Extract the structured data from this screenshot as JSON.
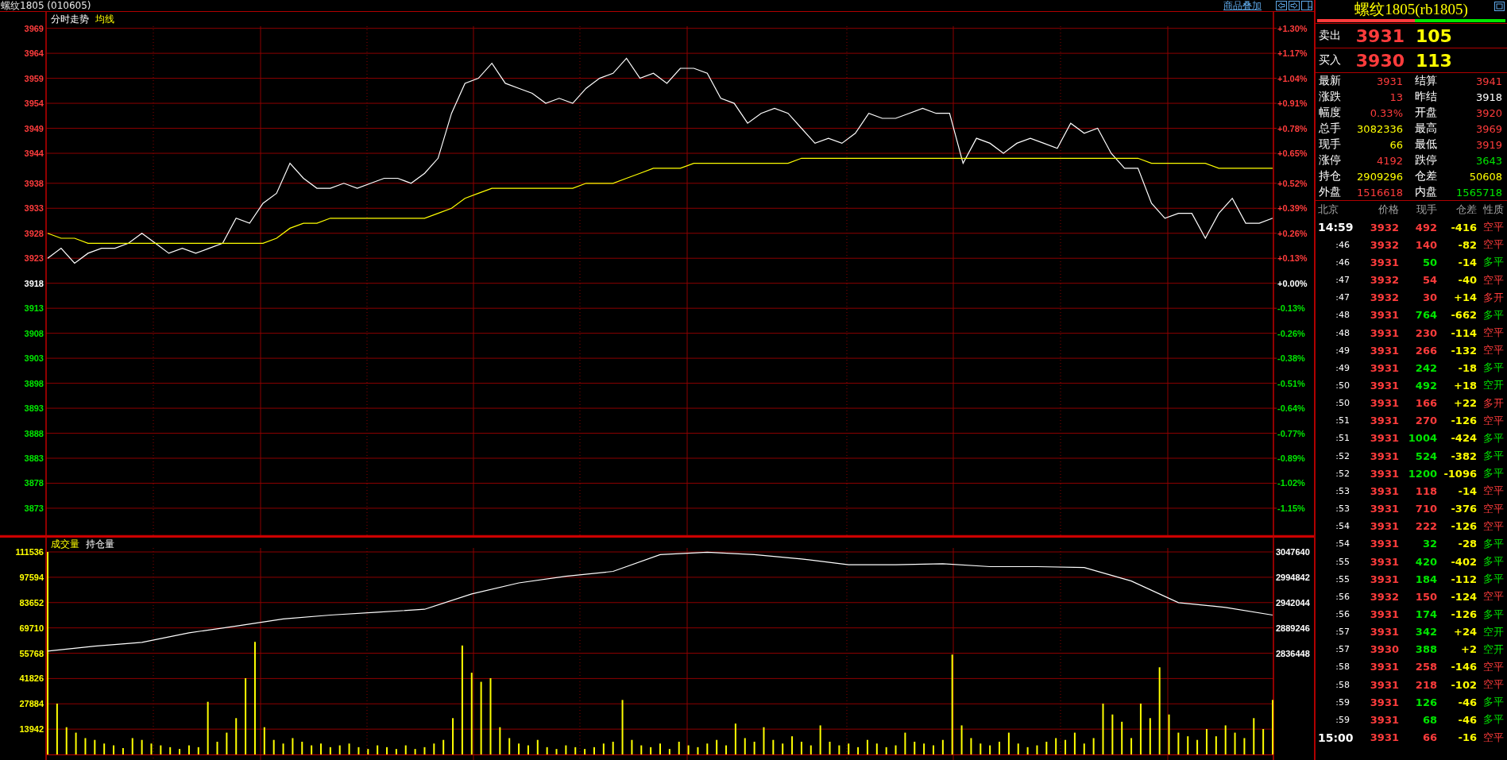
{
  "header": {
    "title": "螺纹1805 (010605)",
    "overlay_link": "商品叠加"
  },
  "price_panel": {
    "chart_data": {
      "type": "line",
      "title": "分时走势",
      "grid": true,
      "series": [
        {
          "color": "#ffffff",
          "values": [
            3923,
            3925,
            3922,
            3924,
            3925,
            3925,
            3926,
            3928,
            3926,
            3924,
            3925,
            3924,
            3925,
            3926,
            3931,
            3930,
            3934,
            3936,
            3942,
            3939,
            3937,
            3937,
            3938,
            3937,
            3938,
            3939,
            3939,
            3938,
            3940,
            3943,
            3952,
            3958,
            3959,
            3962,
            3958,
            3957,
            3956,
            3954,
            3955,
            3954,
            3957,
            3959,
            3960,
            3963,
            3959,
            3960,
            3958,
            3961,
            3961,
            3960,
            3955,
            3954,
            3950,
            3952,
            3953,
            3952,
            3949,
            3946,
            3947,
            3946,
            3948,
            3952,
            3951,
            3951,
            3952,
            3953,
            3952,
            3952,
            3942,
            3947,
            3946,
            3944,
            3946,
            3947,
            3946,
            3945,
            3950,
            3948,
            3949,
            3944,
            3941,
            3941,
            3934,
            3931,
            3932,
            3932,
            3927,
            3932,
            3935,
            3930,
            3930,
            3931
          ]
        },
        {
          "name": "均线",
          "color": "#ffff00",
          "values": [
            3928,
            3927,
            3927,
            3926,
            3926,
            3926,
            3926,
            3926,
            3926,
            3926,
            3926,
            3926,
            3926,
            3926,
            3926,
            3926,
            3926,
            3927,
            3929,
            3930,
            3930,
            3931,
            3931,
            3931,
            3931,
            3931,
            3931,
            3931,
            3931,
            3932,
            3933,
            3935,
            3936,
            3937,
            3937,
            3937,
            3937,
            3937,
            3937,
            3937,
            3938,
            3938,
            3938,
            3939,
            3940,
            3941,
            3941,
            3941,
            3942,
            3942,
            3942,
            3942,
            3942,
            3942,
            3942,
            3942,
            3943,
            3943,
            3943,
            3943,
            3943,
            3943,
            3943,
            3943,
            3943,
            3943,
            3943,
            3943,
            3943,
            3943,
            3943,
            3943,
            3943,
            3943,
            3943,
            3943,
            3943,
            3943,
            3943,
            3943,
            3943,
            3943,
            3942,
            3942,
            3942,
            3942,
            3942,
            3941,
            3941,
            3941,
            3941,
            3941
          ]
        }
      ],
      "ylim": [
        3867.75,
        3969.42
      ],
      "yticks": [
        3969,
        3964,
        3959,
        3954,
        3949,
        3944,
        3938,
        3933,
        3928,
        3923,
        3918,
        3913,
        3908,
        3903,
        3898,
        3893,
        3888,
        3883,
        3878,
        3873
      ]
    },
    "percent_axis": [
      {
        "label": "+1.30%",
        "color": "#ff3c3c"
      },
      {
        "label": "+1.17%",
        "color": "#ff3c3c"
      },
      {
        "label": "+1.04%",
        "color": "#ff3c3c"
      },
      {
        "label": "+0.91%",
        "color": "#ff3c3c"
      },
      {
        "label": "+0.78%",
        "color": "#ff3c3c"
      },
      {
        "label": "+0.65%",
        "color": "#ff3c3c"
      },
      {
        "label": "+0.52%",
        "color": "#ff3c3c"
      },
      {
        "label": "+0.39%",
        "color": "#ff3c3c"
      },
      {
        "label": "+0.26%",
        "color": "#ff3c3c"
      },
      {
        "label": "+0.13%",
        "color": "#ff3c3c"
      },
      {
        "label": "+0.00%",
        "color": "#ffffff"
      },
      {
        "label": "-0.13%",
        "color": "#00e600"
      },
      {
        "label": "-0.26%",
        "color": "#00e600"
      },
      {
        "label": "-0.38%",
        "color": "#00e600"
      },
      {
        "label": "-0.51%",
        "color": "#00e600"
      },
      {
        "label": "-0.64%",
        "color": "#00e600"
      },
      {
        "label": "-0.77%",
        "color": "#00e600"
      },
      {
        "label": "-0.89%",
        "color": "#00e600"
      },
      {
        "label": "-1.02%",
        "color": "#00e600"
      },
      {
        "label": "-1.15%",
        "color": "#00e600"
      }
    ]
  },
  "volume_panel": {
    "volume": {
      "chart_data": {
        "type": "bar",
        "grid": true,
        "series": [
          {
            "name": "成交量",
            "color": "#ffff00",
            "values": [
              111500,
              28000,
              15000,
              12000,
              9000,
              8000,
              6000,
              5000,
              3500,
              9000,
              8000,
              6000,
              5000,
              4000,
              3000,
              5000,
              4000,
              29000,
              7000,
              12000,
              20000,
              42000,
              62000,
              15000,
              8000,
              6000,
              9000,
              7000,
              5000,
              6000,
              4000,
              5000,
              6000,
              4000,
              3000,
              5000,
              4000,
              3000,
              5000,
              3000,
              4000,
              6000,
              8000,
              20000,
              60000,
              45000,
              40000,
              42000,
              15000,
              9000,
              6000,
              5000,
              8000,
              4000,
              3000,
              5000,
              4000,
              3000,
              4000,
              6000,
              7000,
              30000,
              8000,
              5000,
              4000,
              6000,
              3000,
              7000,
              5000,
              4000,
              6000,
              8000,
              5000,
              17000,
              9000,
              7000,
              15000,
              8000,
              6000,
              10000,
              7000,
              5000,
              16000,
              7000,
              5000,
              6000,
              4000,
              8000,
              6000,
              4000,
              5000,
              12000,
              7000,
              6000,
              5000,
              8000,
              55000,
              16000,
              9000,
              6000,
              5000,
              7000,
              12000,
              6000,
              4000,
              5000,
              7000,
              9000,
              8000,
              12000,
              6000,
              9000,
              28000,
              22000,
              18000,
              9000,
              28000,
              20000,
              48000,
              22000,
              12000,
              10000,
              8000,
              14000,
              10000,
              16000,
              12000,
              9000,
              20000,
              14000,
              30000
            ]
          }
        ],
        "ylim": [
          0,
          113723
        ],
        "yticks": [
          {
            "value": 111536,
            "label": "111536"
          },
          {
            "value": 97594,
            "label": "97594"
          },
          {
            "value": 83652,
            "label": "83652"
          },
          {
            "value": 69710,
            "label": "69710"
          },
          {
            "value": 55768,
            "label": "55768"
          },
          {
            "value": 41826,
            "label": "41826"
          },
          {
            "value": 27884,
            "label": "27884"
          },
          {
            "value": 13942,
            "label": "13942"
          }
        ]
      }
    },
    "open_interest": {
      "chart_data": {
        "type": "line",
        "series": [
          {
            "name": "持仓量",
            "color": "#ffffff",
            "values": [
              2841000,
              2851000,
              2859000,
              2879000,
              2893000,
              2908000,
              2916000,
              2922000,
              2928000,
              2960000,
              2983000,
              2997000,
              3007000,
              3042000,
              3047000,
              3042000,
              3033000,
              3021000,
              3021000,
              3023000,
              3017000,
              3017000,
              3015000,
              2987000,
              2942000,
              2932000,
              2916000
            ]
          }
        ],
        "ylim": [
          2836448,
          3047640
        ],
        "yticks": [
          3047640,
          2994842,
          2942044,
          2889246,
          2836448
        ]
      }
    }
  },
  "quote": {
    "title": "螺纹1805(rb1805)",
    "ratio_bar": {
      "level": 0.52
    },
    "ask": {
      "label": "卖出",
      "price": "3931",
      "volume": "105"
    },
    "bid": {
      "label": "买入",
      "price": "3930",
      "volume": "113"
    },
    "stats": [
      {
        "label": "最新",
        "value": "3931",
        "color": "#ff3c3c"
      },
      {
        "label": "结算",
        "value": "3941",
        "color": "#ff3c3c"
      },
      {
        "label": "涨跌",
        "value": "13",
        "color": "#ff3c3c"
      },
      {
        "label": "昨结",
        "value": "3918",
        "color": "#ffffff"
      },
      {
        "label": "幅度",
        "value": "0.33%",
        "color": "#ff3c3c"
      },
      {
        "label": "开盘",
        "value": "3920",
        "color": "#ff3c3c"
      },
      {
        "label": "总手",
        "value": "3082336",
        "color": "#ffff00"
      },
      {
        "label": "最高",
        "value": "3969",
        "color": "#ff3c3c"
      },
      {
        "label": "现手",
        "value": "66",
        "color": "#ffff00"
      },
      {
        "label": "最低",
        "value": "3919",
        "color": "#ff3c3c"
      },
      {
        "label": "涨停",
        "value": "4192",
        "color": "#ff3c3c"
      },
      {
        "label": "跌停",
        "value": "3643",
        "color": "#00e600"
      },
      {
        "label": "持仓",
        "value": "2909296",
        "color": "#ffff00"
      },
      {
        "label": "仓差",
        "value": "50608",
        "color": "#ffff00"
      },
      {
        "label": "外盘",
        "value": "1516618",
        "color": "#ff3c3c"
      },
      {
        "label": "内盘",
        "value": "1565718",
        "color": "#00e600"
      }
    ],
    "trade_columns": [
      "北京",
      "价格",
      "现手",
      "仓差",
      "性质"
    ],
    "trades": [
      {
        "time": "14:59",
        "kind": "hour",
        "price": "3932",
        "volume": "492",
        "change": "-416",
        "type": "空平",
        "color": "#ff3c3c"
      },
      {
        "time": ":46",
        "kind": "minute",
        "price": "3932",
        "volume": "140",
        "change": "-82",
        "type": "空平",
        "color": "#ff3c3c"
      },
      {
        "time": ":46",
        "kind": "minute",
        "price": "3931",
        "volume": "50",
        "change": "-14",
        "type": "多平",
        "color": "#00e600"
      },
      {
        "time": ":47",
        "kind": "minute",
        "price": "3932",
        "volume": "54",
        "change": "-40",
        "type": "空平",
        "color": "#ff3c3c"
      },
      {
        "time": ":47",
        "kind": "minute",
        "price": "3932",
        "volume": "30",
        "change": "+14",
        "type": "多开",
        "color": "#ff3c3c"
      },
      {
        "time": ":48",
        "kind": "minute",
        "price": "3931",
        "volume": "764",
        "change": "-662",
        "type": "多平",
        "color": "#00e600"
      },
      {
        "time": ":48",
        "kind": "minute",
        "price": "3931",
        "volume": "230",
        "change": "-114",
        "type": "空平",
        "color": "#ff3c3c"
      },
      {
        "time": ":49",
        "kind": "minute",
        "price": "3931",
        "volume": "266",
        "change": "-132",
        "type": "空平",
        "color": "#ff3c3c"
      },
      {
        "time": ":49",
        "kind": "minute",
        "price": "3931",
        "volume": "242",
        "change": "-18",
        "type": "多平",
        "color": "#00e600"
      },
      {
        "time": ":50",
        "kind": "minute",
        "price": "3931",
        "volume": "492",
        "change": "+18",
        "type": "空开",
        "color": "#00e600"
      },
      {
        "time": ":50",
        "kind": "minute",
        "price": "3931",
        "volume": "166",
        "change": "+22",
        "type": "多开",
        "color": "#ff3c3c"
      },
      {
        "time": ":51",
        "kind": "minute",
        "price": "3931",
        "volume": "270",
        "change": "-126",
        "type": "空平",
        "color": "#ff3c3c"
      },
      {
        "time": ":51",
        "kind": "minute",
        "price": "3931",
        "volume": "1004",
        "change": "-424",
        "type": "多平",
        "color": "#00e600"
      },
      {
        "time": ":52",
        "kind": "minute",
        "price": "3931",
        "volume": "524",
        "change": "-382",
        "type": "多平",
        "color": "#00e600"
      },
      {
        "time": ":52",
        "kind": "minute",
        "price": "3931",
        "volume": "1200",
        "change": "-1096",
        "type": "多平",
        "color": "#00e600"
      },
      {
        "time": ":53",
        "kind": "minute",
        "price": "3931",
        "volume": "118",
        "change": "-14",
        "type": "空平",
        "color": "#ff3c3c"
      },
      {
        "time": ":53",
        "kind": "minute",
        "price": "3931",
        "volume": "710",
        "change": "-376",
        "type": "空平",
        "color": "#ff3c3c"
      },
      {
        "time": ":54",
        "kind": "minute",
        "price": "3931",
        "volume": "222",
        "change": "-126",
        "type": "空平",
        "color": "#ff3c3c"
      },
      {
        "time": ":54",
        "kind": "minute",
        "price": "3931",
        "volume": "32",
        "change": "-28",
        "type": "多平",
        "color": "#00e600"
      },
      {
        "time": ":55",
        "kind": "minute",
        "price": "3931",
        "volume": "420",
        "change": "-402",
        "type": "多平",
        "color": "#00e600"
      },
      {
        "time": ":55",
        "kind": "minute",
        "price": "3931",
        "volume": "184",
        "change": "-112",
        "type": "多平",
        "color": "#00e600"
      },
      {
        "time": ":56",
        "kind": "minute",
        "price": "3932",
        "volume": "150",
        "change": "-124",
        "type": "空平",
        "color": "#ff3c3c"
      },
      {
        "time": ":56",
        "kind": "minute",
        "price": "3931",
        "volume": "174",
        "change": "-126",
        "type": "多平",
        "color": "#00e600"
      },
      {
        "time": ":57",
        "kind": "minute",
        "price": "3931",
        "volume": "342",
        "change": "+24",
        "type": "空开",
        "color": "#00e600"
      },
      {
        "time": ":57",
        "kind": "minute",
        "price": "3930",
        "volume": "388",
        "change": "+2",
        "type": "空开",
        "color": "#00e600"
      },
      {
        "time": ":58",
        "kind": "minute",
        "price": "3931",
        "volume": "258",
        "change": "-146",
        "type": "空平",
        "color": "#ff3c3c"
      },
      {
        "time": ":58",
        "kind": "minute",
        "price": "3931",
        "volume": "218",
        "change": "-102",
        "type": "空平",
        "color": "#ff3c3c"
      },
      {
        "time": ":59",
        "kind": "minute",
        "price": "3931",
        "volume": "126",
        "change": "-46",
        "type": "多平",
        "color": "#00e600"
      },
      {
        "time": ":59",
        "kind": "minute",
        "price": "3931",
        "volume": "68",
        "change": "-46",
        "type": "多平",
        "color": "#00e600"
      },
      {
        "time": "15:00",
        "kind": "hour",
        "price": "3931",
        "volume": "66",
        "change": "-16",
        "type": "空平",
        "color": "#ff3c3c"
      }
    ]
  }
}
